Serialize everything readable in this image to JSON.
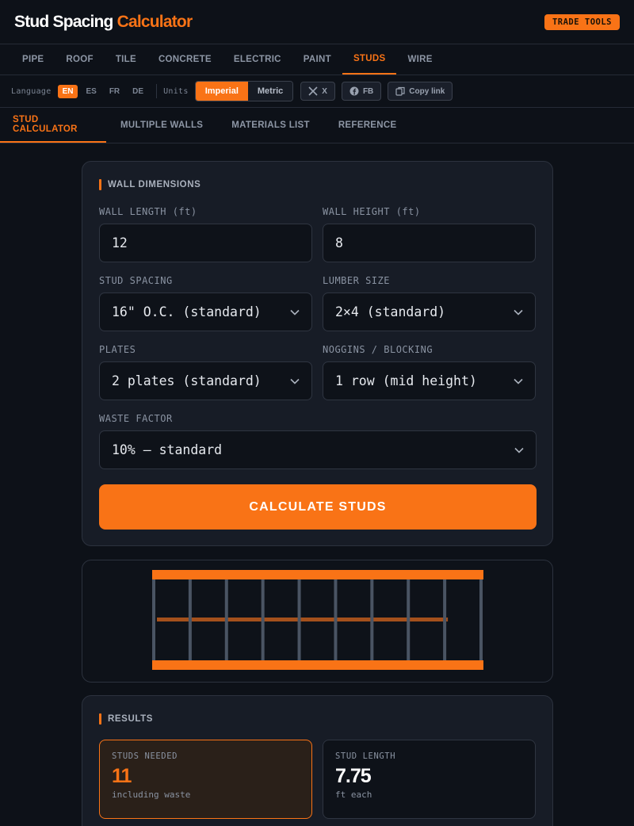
{
  "header": {
    "brand_main": "Stud Spacing",
    "brand_accent": "Calculator",
    "trade_tools": "TRADE TOOLS"
  },
  "categories": [
    "PIPE",
    "ROOF",
    "TILE",
    "CONCRETE",
    "ELECTRIC",
    "PAINT",
    "STUDS",
    "WIRE"
  ],
  "toolbar": {
    "language_label": "Language",
    "languages": [
      "EN",
      "ES",
      "FR",
      "DE"
    ],
    "units_label": "Units",
    "units": [
      "Imperial",
      "Metric"
    ],
    "share_x": "X",
    "share_fb": "FB",
    "copy_link": "Copy link"
  },
  "subtabs": [
    "STUD CALCULATOR",
    "MULTIPLE WALLS",
    "MATERIALS LIST",
    "REFERENCE"
  ],
  "form": {
    "section_title": "WALL DIMENSIONS",
    "wall_length_label": "WALL LENGTH (ft)",
    "wall_length_value": "12",
    "wall_height_label": "WALL HEIGHT (ft)",
    "wall_height_value": "8",
    "stud_spacing_label": "STUD SPACING",
    "stud_spacing_value": "16\" O.C. (standard)",
    "lumber_size_label": "LUMBER SIZE",
    "lumber_size_value": "2×4 (standard)",
    "plates_label": "PLATES",
    "plates_value": "2 plates (standard)",
    "noggins_label": "NOGGINS / BLOCKING",
    "noggins_value": "1 row (mid height)",
    "waste_label": "WASTE FACTOR",
    "waste_value": "10% — standard",
    "calculate_label": "CALCULATE STUDS"
  },
  "diagram": {
    "stud_count": 10,
    "plate_color": "#f97316",
    "stud_color": "#4a5463",
    "nogging_color": "#a4501c"
  },
  "results": {
    "section_title": "RESULTS",
    "studs_needed_label": "STUDS NEEDED",
    "studs_needed_value": "11",
    "studs_needed_sub": "including waste",
    "stud_length_label": "STUD LENGTH",
    "stud_length_value": "7.75",
    "stud_length_sub": "ft each"
  },
  "colors": {
    "accent": "#f97316",
    "background": "#0d1118",
    "card": "#171c26"
  }
}
